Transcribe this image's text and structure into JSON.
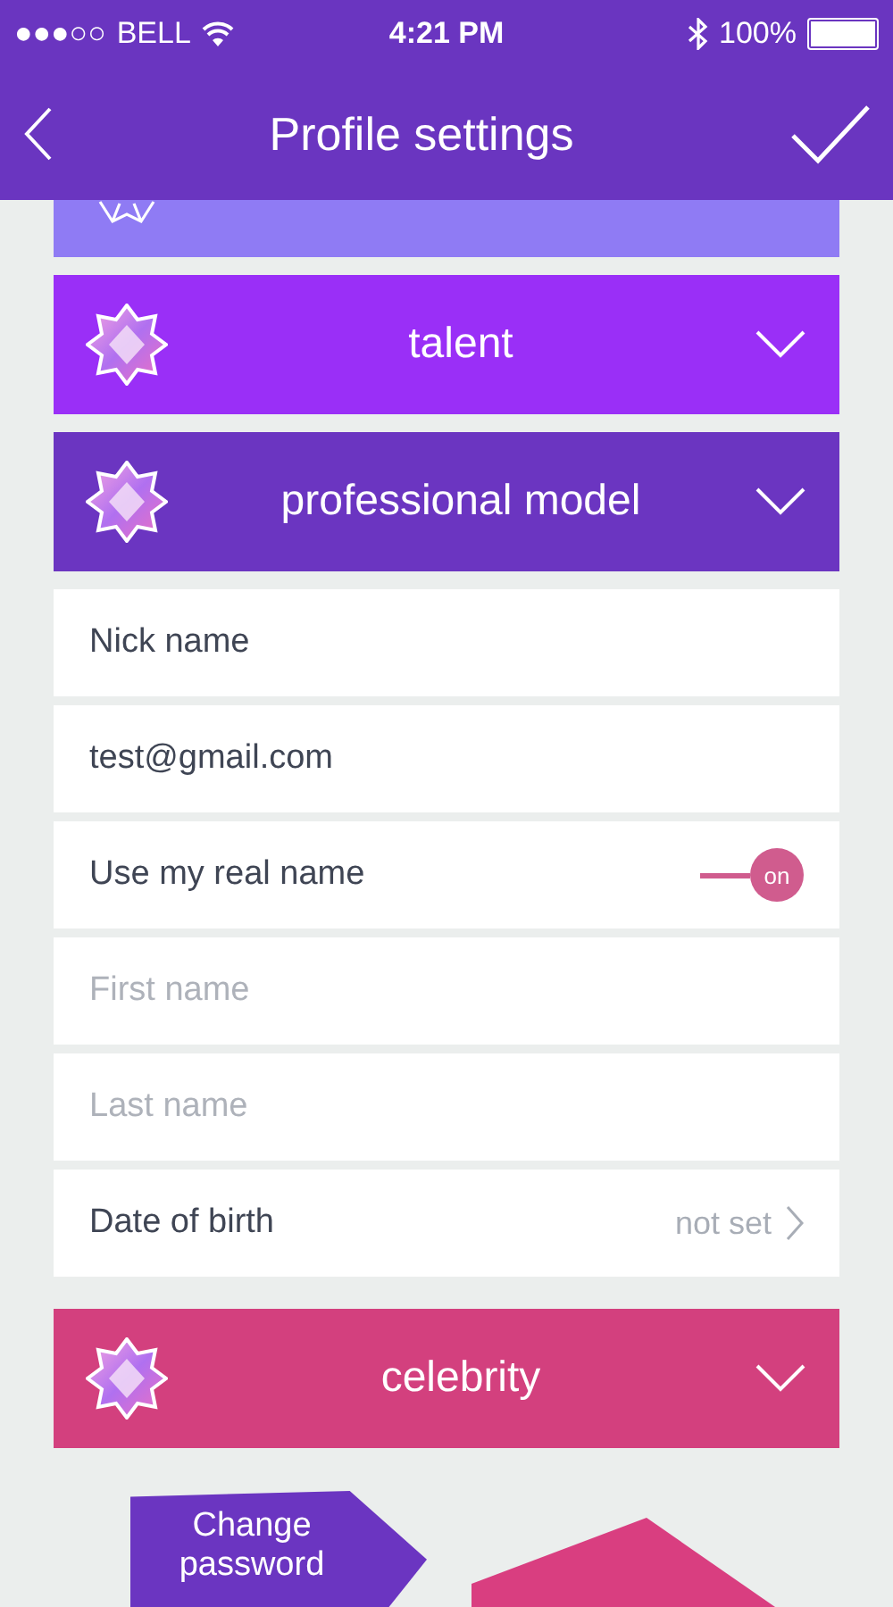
{
  "status_bar": {
    "signal": "●●●○○",
    "carrier": "BELL",
    "time": "4:21 PM",
    "battery": "100%"
  },
  "header": {
    "title": "Profile settings"
  },
  "levels": [
    {
      "kind": "outline",
      "color": "#8f7bf4"
    },
    {
      "kind": "gem",
      "label": "talent",
      "color": "#9a2ff7"
    },
    {
      "kind": "gem",
      "label": "professional model",
      "color": "#6b35c1"
    },
    {
      "kind": "gem",
      "label": "celebrity",
      "color": "#d3407e"
    }
  ],
  "fields": [
    {
      "kind": "input",
      "value": "Nick name"
    },
    {
      "kind": "input",
      "value": "test@gmail.com"
    },
    {
      "kind": "toggle",
      "label": "Use my real name",
      "on": true,
      "state_label": "on"
    },
    {
      "kind": "input",
      "placeholder": "First name"
    },
    {
      "kind": "input",
      "placeholder": "Last name"
    },
    {
      "kind": "link",
      "label": "Date of birth",
      "value": "not set"
    }
  ],
  "buttons": [
    {
      "label": "Change password"
    }
  ]
}
